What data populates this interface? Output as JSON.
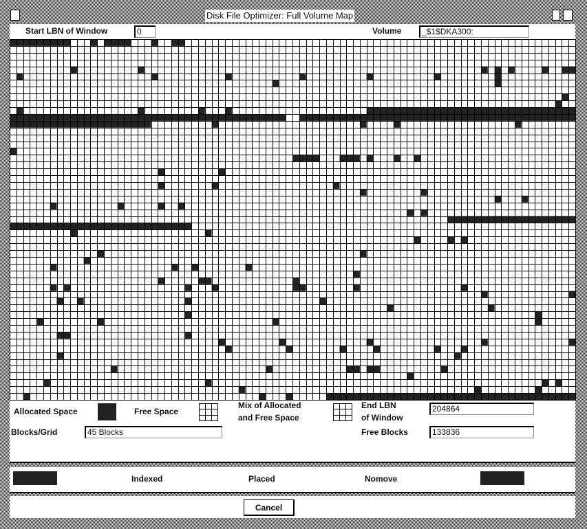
{
  "window": {
    "title": "Disk File Optimizer: Full Volume Map"
  },
  "header": {
    "start_lbn_label": "Start LBN of Window",
    "start_lbn_value": "0",
    "volume_label": "Volume",
    "volume_value": "_$1$DKA300:"
  },
  "map": {
    "columns": 84,
    "rows": 53,
    "allocated_color": "#222222",
    "allocated_runs": [
      [
        0,
        0,
        8
      ],
      [
        0,
        12,
        12
      ],
      [
        0,
        14,
        17
      ],
      [
        0,
        21,
        21
      ],
      [
        0,
        24,
        25
      ],
      [
        4,
        9,
        9
      ],
      [
        4,
        19,
        19
      ],
      [
        4,
        70,
        70
      ],
      [
        4,
        72,
        72
      ],
      [
        4,
        74,
        74
      ],
      [
        4,
        79,
        79
      ],
      [
        4,
        82,
        83
      ],
      [
        5,
        1,
        1
      ],
      [
        5,
        21,
        21
      ],
      [
        5,
        32,
        32
      ],
      [
        5,
        43,
        43
      ],
      [
        5,
        53,
        53
      ],
      [
        5,
        63,
        63
      ],
      [
        5,
        72,
        72
      ],
      [
        6,
        39,
        39
      ],
      [
        6,
        72,
        72
      ],
      [
        8,
        82,
        82
      ],
      [
        9,
        81,
        81
      ],
      [
        10,
        1,
        1
      ],
      [
        10,
        19,
        19
      ],
      [
        10,
        28,
        28
      ],
      [
        10,
        32,
        32
      ],
      [
        10,
        53,
        83
      ],
      [
        11,
        0,
        40
      ],
      [
        11,
        43,
        83
      ],
      [
        12,
        0,
        20
      ],
      [
        12,
        30,
        30
      ],
      [
        12,
        52,
        52
      ],
      [
        12,
        57,
        57
      ],
      [
        12,
        75,
        75
      ],
      [
        16,
        0,
        0
      ],
      [
        17,
        42,
        45
      ],
      [
        17,
        49,
        51
      ],
      [
        17,
        53,
        53
      ],
      [
        17,
        57,
        57
      ],
      [
        17,
        60,
        60
      ],
      [
        19,
        22,
        22
      ],
      [
        19,
        31,
        31
      ],
      [
        21,
        22,
        22
      ],
      [
        21,
        30,
        30
      ],
      [
        21,
        48,
        48
      ],
      [
        22,
        52,
        52
      ],
      [
        22,
        61,
        61
      ],
      [
        23,
        72,
        72
      ],
      [
        23,
        76,
        76
      ],
      [
        24,
        6,
        6
      ],
      [
        24,
        16,
        16
      ],
      [
        24,
        22,
        22
      ],
      [
        24,
        25,
        25
      ],
      [
        25,
        59,
        59
      ],
      [
        25,
        61,
        61
      ],
      [
        26,
        65,
        83
      ],
      [
        27,
        0,
        26
      ],
      [
        28,
        9,
        9
      ],
      [
        28,
        29,
        29
      ],
      [
        29,
        60,
        60
      ],
      [
        29,
        65,
        65
      ],
      [
        29,
        67,
        67
      ],
      [
        31,
        13,
        13
      ],
      [
        31,
        52,
        52
      ],
      [
        32,
        11,
        11
      ],
      [
        33,
        6,
        6
      ],
      [
        33,
        24,
        24
      ],
      [
        33,
        27,
        27
      ],
      [
        33,
        35,
        35
      ],
      [
        34,
        51,
        51
      ],
      [
        35,
        22,
        22
      ],
      [
        35,
        28,
        29
      ],
      [
        35,
        42,
        42
      ],
      [
        36,
        6,
        6
      ],
      [
        36,
        8,
        8
      ],
      [
        36,
        26,
        26
      ],
      [
        36,
        30,
        30
      ],
      [
        36,
        42,
        43
      ],
      [
        36,
        51,
        51
      ],
      [
        36,
        67,
        67
      ],
      [
        37,
        70,
        70
      ],
      [
        37,
        83,
        83
      ],
      [
        38,
        7,
        7
      ],
      [
        38,
        10,
        10
      ],
      [
        38,
        26,
        26
      ],
      [
        38,
        46,
        46
      ],
      [
        39,
        56,
        56
      ],
      [
        39,
        71,
        71
      ],
      [
        40,
        26,
        26
      ],
      [
        40,
        78,
        78
      ],
      [
        41,
        4,
        4
      ],
      [
        41,
        13,
        13
      ],
      [
        41,
        39,
        39
      ],
      [
        41,
        78,
        78
      ],
      [
        43,
        7,
        8
      ],
      [
        43,
        26,
        26
      ],
      [
        44,
        31,
        31
      ],
      [
        44,
        40,
        40
      ],
      [
        44,
        53,
        53
      ],
      [
        44,
        70,
        70
      ],
      [
        44,
        83,
        83
      ],
      [
        45,
        32,
        32
      ],
      [
        45,
        41,
        41
      ],
      [
        45,
        49,
        49
      ],
      [
        45,
        54,
        54
      ],
      [
        45,
        63,
        63
      ],
      [
        45,
        67,
        67
      ],
      [
        46,
        7,
        7
      ],
      [
        46,
        66,
        66
      ],
      [
        48,
        15,
        15
      ],
      [
        48,
        38,
        38
      ],
      [
        48,
        50,
        51
      ],
      [
        48,
        53,
        54
      ],
      [
        48,
        64,
        64
      ],
      [
        49,
        59,
        59
      ],
      [
        50,
        5,
        5
      ],
      [
        50,
        29,
        29
      ],
      [
        50,
        79,
        79
      ],
      [
        50,
        81,
        81
      ],
      [
        51,
        34,
        34
      ],
      [
        51,
        69,
        69
      ],
      [
        51,
        78,
        78
      ],
      [
        52,
        2,
        2
      ],
      [
        52,
        37,
        37
      ],
      [
        52,
        41,
        41
      ],
      [
        52,
        47,
        83
      ]
    ]
  },
  "legend": {
    "allocated_label": "Allocated Space",
    "free_label": "Free Space",
    "mix_label_line1": "Mix of Allocated",
    "mix_label_line2": "and Free Space",
    "end_lbn_label_line1": "End LBN",
    "end_lbn_label_line2": "of Window",
    "end_lbn_value": "204864",
    "blocks_grid_label": "Blocks/Grid",
    "blocks_grid_value": "45 Blocks",
    "free_blocks_label": "Free Blocks",
    "free_blocks_value": "133836"
  },
  "flags": {
    "indexed": "Indexed",
    "placed": "Placed",
    "nomove": "Nomove"
  },
  "buttons": {
    "cancel": "Cancel"
  }
}
